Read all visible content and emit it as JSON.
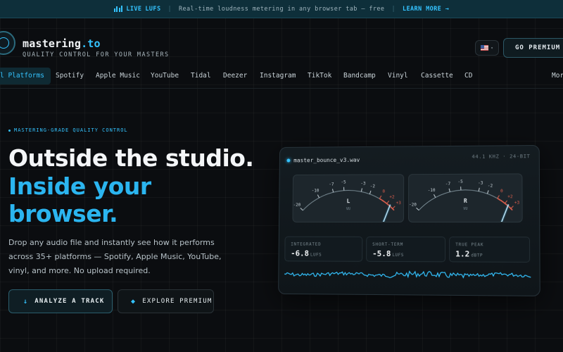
{
  "banner": {
    "live_label": "LIVE",
    "lufs_label": "LUFS",
    "separator": "|",
    "message": "Real-time loudness metering in any browser tab — free",
    "link_label": "LEARN MORE →"
  },
  "header": {
    "brand_name": "mastering",
    "brand_tld": ".to",
    "tagline": "QUALITY CONTROL FOR YOUR MASTERS",
    "flag_chevron": "▾",
    "premium_button": "GO PREMIUM →"
  },
  "nav": {
    "items": [
      {
        "label": "l Platforms",
        "active": true
      },
      {
        "label": "Spotify"
      },
      {
        "label": "Apple Music"
      },
      {
        "label": "YouTube"
      },
      {
        "label": "Tidal"
      },
      {
        "label": "Deezer"
      },
      {
        "label": "Instagram"
      },
      {
        "label": "TikTok"
      },
      {
        "label": "Bandcamp"
      },
      {
        "label": "Vinyl"
      },
      {
        "label": "Cassette"
      },
      {
        "label": "CD"
      },
      {
        "label": "Mor"
      }
    ]
  },
  "hero": {
    "eyebrow": "MASTERING-GRADE QUALITY CONTROL",
    "title_line1": "Outside the studio.",
    "title_line2": "Inside your",
    "title_line3": "browser.",
    "description": "Drop any audio file and instantly see how it performs across 35+ platforms — Spotify, Apple Music, YouTube, vinyl, and more. No upload required.",
    "analyze_icon": "↓",
    "analyze_button": "ANALYZE A TRACK",
    "explore_icon": "◆",
    "explore_button": "EXPLORE PREMIUM"
  },
  "panel": {
    "filename": "master_bounce_v3.wav",
    "spec": "44.1 KHZ · 24-BIT",
    "meters": [
      {
        "channel": "L",
        "unit": "VU",
        "scale": [
          "-20",
          "-10",
          "-7",
          "-5",
          "-3",
          "-2",
          "0",
          "+2",
          "+3"
        ]
      },
      {
        "channel": "R",
        "unit": "VU",
        "scale": [
          "-20",
          "-10",
          "-7",
          "-5",
          "-3",
          "-2",
          "0",
          "+2",
          "+3"
        ]
      }
    ],
    "stats": [
      {
        "label": "INTEGRATED",
        "value": "-6.8",
        "unit": "LUFS"
      },
      {
        "label": "SHORT-TERM",
        "value": "-5.8",
        "unit": "LUFS"
      },
      {
        "label": "TRUE PEAK",
        "value": "1.2",
        "unit": "dBTP"
      }
    ]
  },
  "colors": {
    "accent": "#34c3ff",
    "background": "#0b0d10",
    "banner_bg": "#0e2f3a",
    "meter_red": "#e0604e"
  }
}
